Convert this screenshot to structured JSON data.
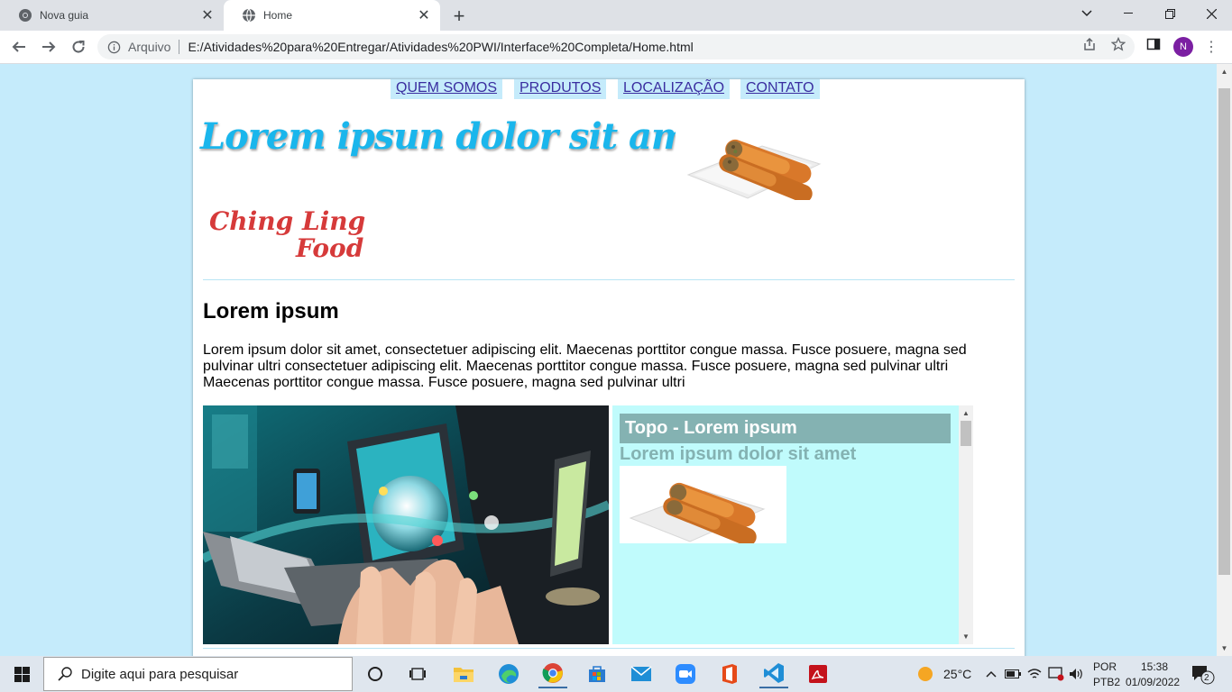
{
  "browser": {
    "tabs": [
      {
        "title": "Nova guia",
        "active": false
      },
      {
        "title": "Home",
        "active": true
      }
    ],
    "omnibox": {
      "security_label": "Arquivo",
      "url": "E:/Atividades%20para%20Entregar/Atividades%20PWI/Interface%20Completa/Home.html"
    },
    "profile_initial": "N"
  },
  "page": {
    "nav": [
      "QUEM SOMOS",
      "PRODUTOS",
      "LOCALIZAÇÃO",
      "CONTATO"
    ],
    "site_title": "Lorem ipsun dolor sit amet",
    "logo_text": [
      "Ching Ling",
      "Food"
    ],
    "section_title": "Lorem ipsum",
    "section_text": "Lorem ipsum dolor sit amet, consectetuer adipiscing elit. Maecenas porttitor congue massa. Fusce posuere, magna sed pulvinar ultri consectetuer adipiscing elit. Maecenas porttitor congue massa. Fusce posuere, magna sed pulvinar ultri Maecenas porttitor congue massa. Fusce posuere, magna sed pulvinar ultri",
    "aside": {
      "title": "Topo - Lorem ipsum",
      "subtitle": "Lorem ipsum dolor sit amet"
    }
  },
  "taskbar": {
    "search_placeholder": "Digite aqui para pesquisar",
    "weather": "25°C",
    "language": [
      "POR",
      "PTB2"
    ],
    "time": "15:38",
    "date": "01/09/2022",
    "notifications": "2"
  },
  "colors": {
    "page_background": "#c5ebfb",
    "title_blue": "#1ab6ec",
    "aside_background": "#c0fbfc",
    "aside_title_bg": "#84b2b2",
    "logo_red": "#d63a3a"
  }
}
